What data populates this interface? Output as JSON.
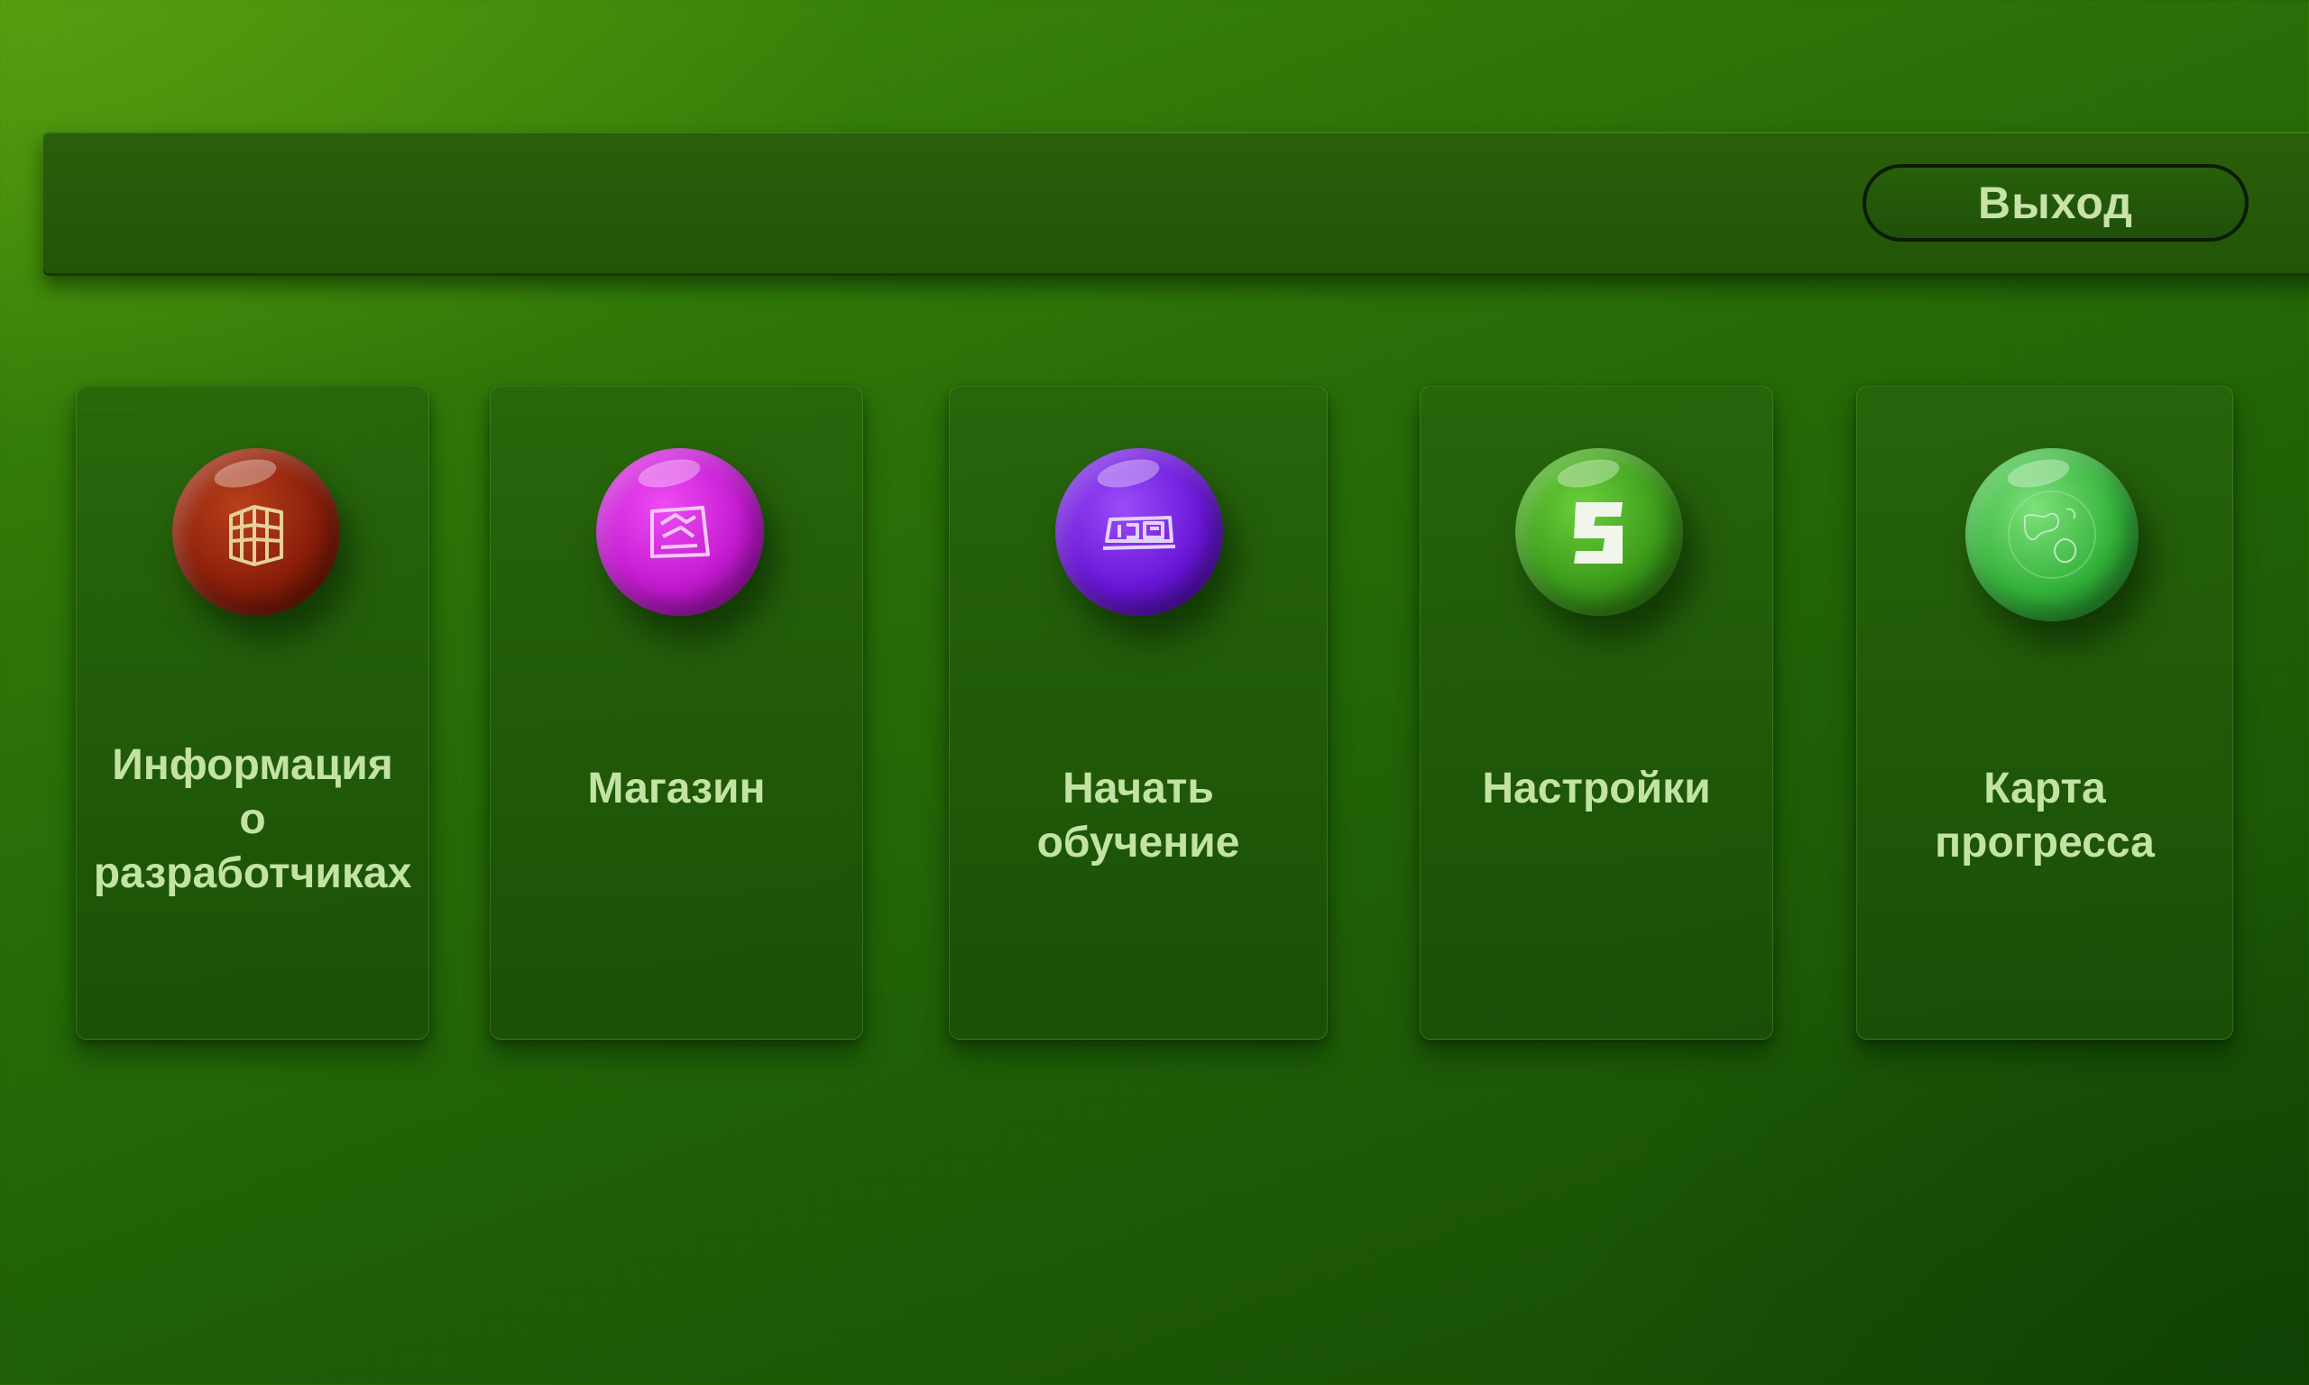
{
  "header": {
    "exit_label": "Выход"
  },
  "cards": [
    {
      "label": "Информация\nо\nразработчиках",
      "icon": "building-icon",
      "color": "#8a1e0a"
    },
    {
      "label": "Магазин",
      "icon": "shop-icon",
      "color": "#c21ad0"
    },
    {
      "label": "Начать\nобучение",
      "icon": "tutorial-icon",
      "color": "#6a16d8"
    },
    {
      "label": "Настройки",
      "icon": "settings-icon",
      "color": "#3c9a1a"
    },
    {
      "label": "Карта\nпрогресса",
      "icon": "globe-icon",
      "color": "#33b23a"
    }
  ],
  "colors": {
    "background": "#2a7008",
    "text": "#c3e3a4"
  }
}
